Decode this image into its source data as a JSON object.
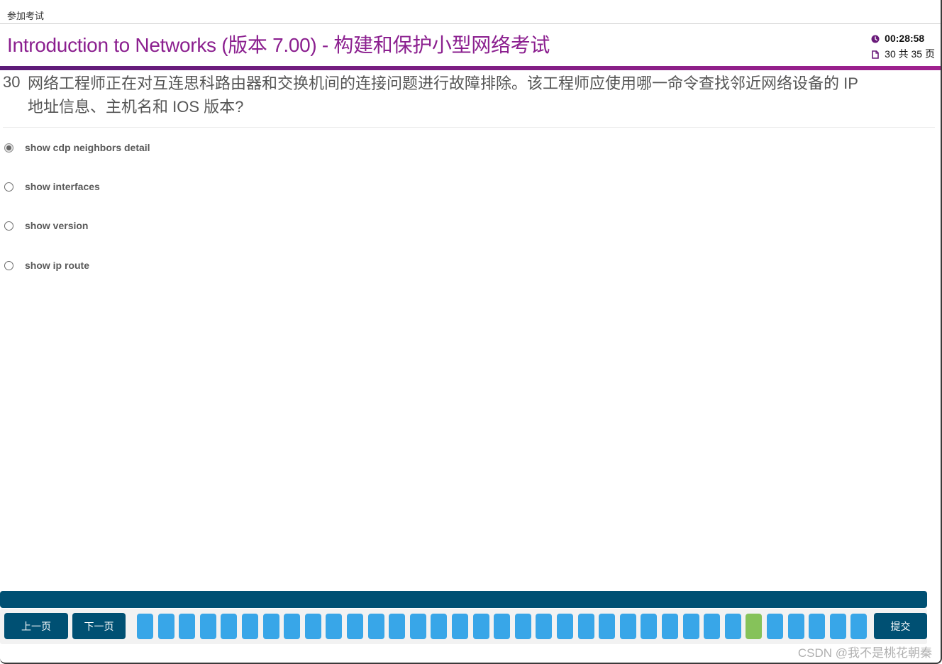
{
  "window": {
    "top_label": "参加考试"
  },
  "header": {
    "title": "Introduction to Networks (版本 7.00) - 构建和保护小型网络考试",
    "timer": "00:28:58",
    "page_status": "30 共 35 页",
    "icons": {
      "timer": "clock-icon",
      "page": "document-icon"
    }
  },
  "question": {
    "number": "30",
    "text": "网络工程师正在对互连思科路由器和交换机间的连接问题进行故障排除。该工程师应使用哪一命令查找邻近网络设备的 IP 地址信息、主机名和 IOS 版本?",
    "options": [
      {
        "label": "show cdp neighbors detail",
        "selected": true
      },
      {
        "label": "show interfaces",
        "selected": false
      },
      {
        "label": "show version",
        "selected": false
      },
      {
        "label": "show ip route",
        "selected": false
      }
    ]
  },
  "navigation": {
    "prev_label": "上一页",
    "next_label": "下一页",
    "submit_label": "提交",
    "total_pages": 35,
    "current_page": 30,
    "colors": {
      "page": "#38a6e8",
      "current": "#86c25a",
      "button": "#005073",
      "title": "#8b1f8f"
    }
  },
  "watermark": "CSDN @我不是桃花朝秦"
}
